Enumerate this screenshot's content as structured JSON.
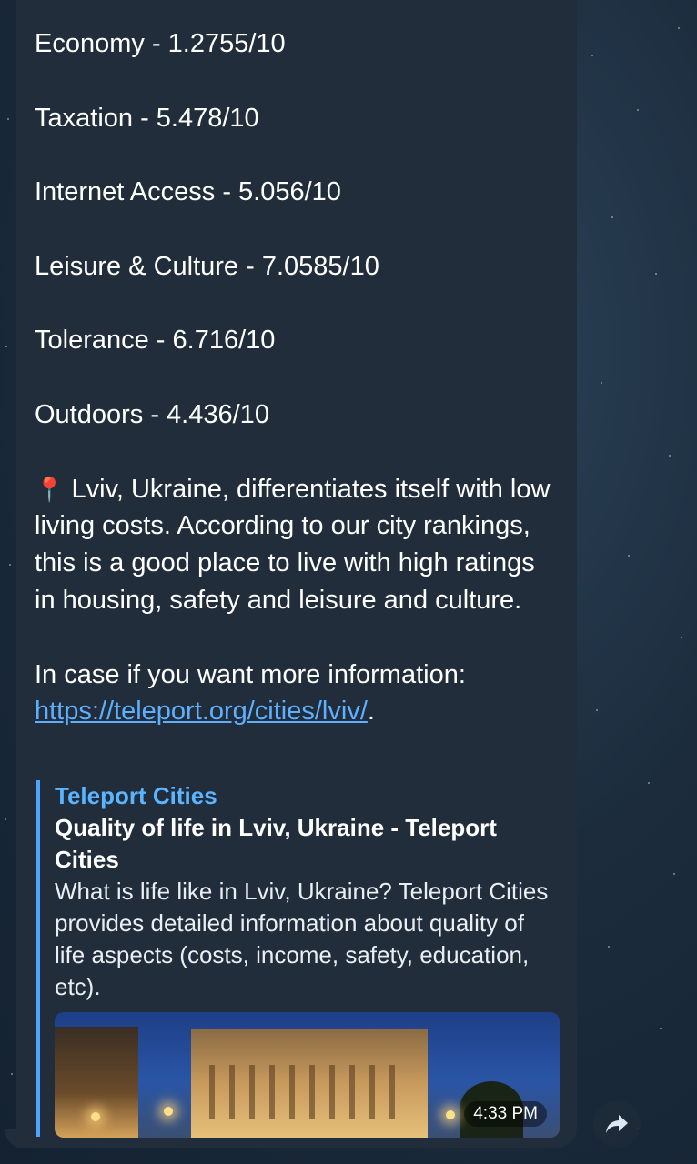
{
  "ratings": [
    {
      "label": "Economy - 1.2755/10"
    },
    {
      "label": "Taxation - 5.478/10"
    },
    {
      "label": "Internet Access - 5.056/10"
    },
    {
      "label": "Leisure & Culture - 7.0585/10"
    },
    {
      "label": "Tolerance - 6.716/10"
    },
    {
      "label": "Outdoors - 4.436/10"
    }
  ],
  "summary": {
    "icon": "pin-icon",
    "text": "Lviv, Ukraine, differentiates itself with low living costs. According to our city rankings, this is a good place to live with high ratings in housing, safety and leisure and culture."
  },
  "more_info": {
    "text": "In case if you want more information:",
    "link": "https://teleport.org/cities/lviv/",
    "trailing": "."
  },
  "preview": {
    "site": "Teleport Cities",
    "title": "Quality of life in Lviv, Ukraine - Teleport Cities",
    "description": "What is life like in Lviv, Ukraine? Teleport Cities provides detailed information about quality of life aspects (costs, income, safety, education, etc).",
    "image": "lviv-opera-house-night-photo"
  },
  "timestamp": "4:33 PM",
  "share_icon": "share-arrow-icon",
  "colors": {
    "bubble": "#212d3b",
    "link": "#5eb0ff",
    "accent_bar": "#4da3ff"
  }
}
